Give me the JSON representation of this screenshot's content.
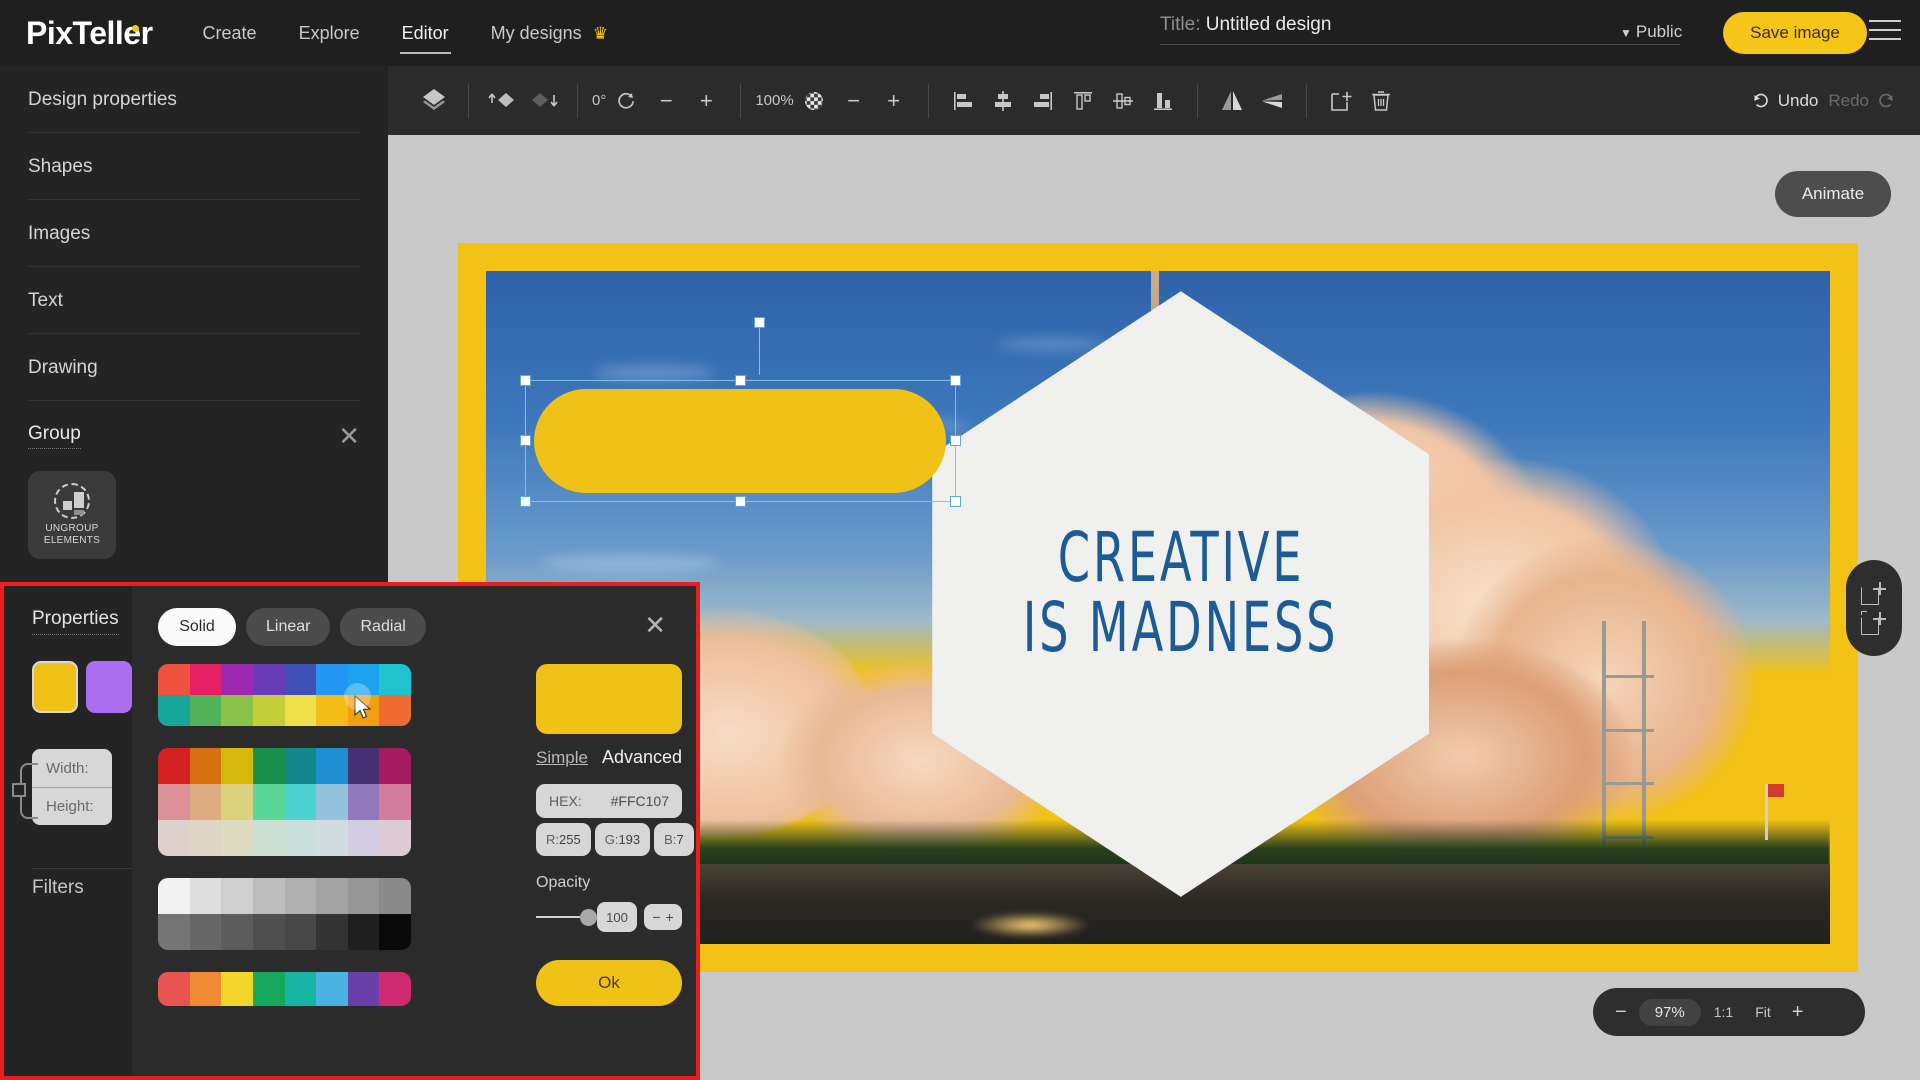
{
  "header": {
    "logo": "PixTeller",
    "nav": [
      {
        "label": "Create",
        "active": false
      },
      {
        "label": "Explore",
        "active": false
      },
      {
        "label": "Editor",
        "active": true
      },
      {
        "label": "My designs",
        "active": false,
        "icon": "crown-icon"
      }
    ],
    "title_label": "Title:",
    "title_value": "Untitled design",
    "visibility": "Public",
    "save_label": "Save image",
    "menu_icon": "hamburger-icon"
  },
  "sidebar": {
    "items": [
      {
        "label": "Design properties"
      },
      {
        "label": "Shapes"
      },
      {
        "label": "Images"
      },
      {
        "label": "Text"
      },
      {
        "label": "Drawing"
      }
    ],
    "group": {
      "label": "Group",
      "close_icon": "close-icon",
      "ungroup_label_line1": "UNGROUP",
      "ungroup_label_line2": "ELEMENTS",
      "ungroup_icon": "ungroup-elements-icon"
    }
  },
  "toolbar": {
    "layers_icon": "layers-icon",
    "bring_forward_icon": "bring-forward-icon",
    "send_backward_icon": "send-backward-icon",
    "rotation_value": "0°",
    "rotation_icon": "rotate-icon",
    "rotation_minus": "−",
    "rotation_plus": "+",
    "opacity_value": "100%",
    "opacity_icon": "checker-opacity-icon",
    "opacity_minus": "−",
    "opacity_plus": "+",
    "align_left_icon": "align-left-icon",
    "align_center_icon": "align-center-icon",
    "align_right_icon": "align-right-icon",
    "align_top_icon": "align-top-icon",
    "align_middle_icon": "align-middle-icon",
    "align_bottom_icon": "align-bottom-icon",
    "flip_horizontal_icon": "flip-horizontal-icon",
    "flip_vertical_icon": "flip-vertical-icon",
    "duplicate_icon": "duplicate-icon",
    "delete_icon": "trash-icon",
    "undo_label": "Undo",
    "redo_label": "Redo"
  },
  "stage": {
    "animate_label": "Animate",
    "add_page_icon": "add-page-icon",
    "duplicate_page_icon": "duplicate-page-icon",
    "zoom": {
      "minus": "−",
      "percent": "97%",
      "one_to_one": "1:1",
      "fit": "Fit",
      "plus": "+"
    }
  },
  "design": {
    "border_color": "#f2c216",
    "hexagon_fill": "#f0f0ee",
    "headline_line1": "CREATIVE",
    "headline_line2": "IS MADNESS",
    "headline_color": "#1d5a96",
    "selected_shape_color": "#f0c116"
  },
  "properties_panel": {
    "title": "Properties",
    "swatch_1": "#f0c116",
    "swatch_2": "#ab6ef0",
    "width_label": "Width:",
    "height_label": "Height:",
    "filters_label": "Filters"
  },
  "color_picker": {
    "modes": [
      {
        "label": "Solid",
        "active": true
      },
      {
        "label": "Linear",
        "active": false
      },
      {
        "label": "Radial",
        "active": false
      }
    ],
    "close_icon": "close-icon",
    "preview_color": "#f0c116",
    "tab_simple": "Simple",
    "tab_advanced": "Advanced",
    "hex_label": "HEX:",
    "hex_value": "#FFC107",
    "r_label": "R:",
    "r_value": "255",
    "g_label": "G:",
    "g_value": "193",
    "b_label": "B:",
    "b_value": "7",
    "opacity_label": "Opacity",
    "opacity_value": "100",
    "opacity_minus": "−",
    "opacity_plus": "+",
    "ok_label": "Ok",
    "highlight_border_color": "#ee1c1c",
    "palettes": [
      {
        "name": "vivid",
        "rows": [
          [
            "#ef5340",
            "#e61e63",
            "#9c27b0",
            "#673ab7",
            "#3f51b5",
            "#2196f3",
            "#1aa3ef",
            "#1fc3cf"
          ],
          [
            "#17a79a",
            "#52b35a",
            "#8bc34a",
            "#c4d03a",
            "#f0e14a",
            "#f3bc16",
            "#f29f12",
            "#ef6b32"
          ]
        ]
      },
      {
        "name": "tints",
        "rows": [
          [
            "#d11f22",
            "#d4720f",
            "#d4b80c",
            "#18904b",
            "#12878c",
            "#1e90cd",
            "#473173",
            "#a61b5d"
          ],
          [
            "#db9197",
            "#ddac82",
            "#ddd17f",
            "#5bd798",
            "#4fd3d2",
            "#94c4dd",
            "#9279bd",
            "#d47c9e"
          ],
          [
            "#ded0cc",
            "#ded5c6",
            "#dedcc0",
            "#ccdfd2",
            "#c9dfdb",
            "#d2dde2",
            "#d2cddf",
            "#ddccd6"
          ]
        ]
      },
      {
        "name": "grayscale",
        "rows": [
          [
            "#f2f2f2",
            "#dedede",
            "#cfcfcf",
            "#bdbdbd",
            "#b0b0b0",
            "#a3a3a3",
            "#969696",
            "#8a8a8a"
          ],
          [
            "#757575",
            "#666666",
            "#5c5c5c",
            "#4f4f4f",
            "#474747",
            "#333333",
            "#1f1f1f",
            "#0a0a0a"
          ]
        ]
      },
      {
        "name": "brand",
        "rows": [
          [
            "#e8544f",
            "#ef8c32",
            "#f2d52a",
            "#16a85c",
            "#17b3a3",
            "#4ab3e3",
            "#6a3fa8",
            "#cf2a70"
          ]
        ]
      }
    ]
  }
}
